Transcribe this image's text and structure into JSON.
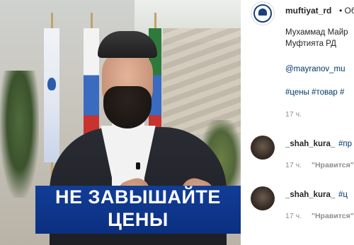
{
  "media": {
    "caption_line1": "НЕ ЗАВЫШАЙТЕ",
    "caption_line2": "ЦЕНЫ"
  },
  "post": {
    "username": "muftiyat_rd",
    "follow_text": "• Об",
    "text_line1": "Мухаммад Майр",
    "text_line2": "Муфтията РД",
    "mention": "@mayranov_mu",
    "hashtags": "#цены #товар #",
    "time": "17 ч."
  },
  "comments": [
    {
      "user": "_shah_kura_",
      "text": "#пр",
      "time": "17 ч.",
      "like": "\"Нравится\""
    },
    {
      "user": "_shah_kura_",
      "text": "#ц",
      "time": "17 ч.",
      "like": "\"Нравится\""
    }
  ],
  "colors": {
    "caption_bg": "#123d96",
    "link": "#00376b",
    "muted": "#8e8e8e",
    "text": "#262626"
  }
}
